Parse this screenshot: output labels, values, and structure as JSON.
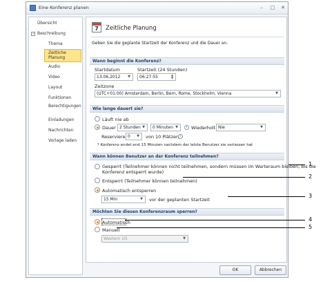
{
  "window": {
    "title": "Eine Konferenz planen"
  },
  "sidebar": {
    "items": [
      {
        "label": "Übersicht"
      },
      {
        "label": "Beschreibung"
      },
      {
        "label": "Thema"
      },
      {
        "label": "Zeitliche Planung"
      },
      {
        "label": "Audio"
      },
      {
        "label": "Video"
      },
      {
        "label": "Layout"
      },
      {
        "label": "Funktionen"
      },
      {
        "label": "Berechtigungen"
      },
      {
        "label": "Einladungen"
      },
      {
        "label": "Nachrichten"
      },
      {
        "label": "Vorlage laden"
      }
    ]
  },
  "main": {
    "calendar_day": "7",
    "heading": "Zeitliche Planung",
    "description": "Geben Sie die geplante Startzeit der Konferenz und die Dauer an.",
    "start": {
      "section": "Wann beginnt die Konferenz?",
      "date_label": "Startdatum",
      "date_value": "13.06.2012",
      "time_label": "Startzeit (24 Stunden)",
      "time_value": "06:27:55",
      "zone_label": "Zeitzone",
      "zone_value": "(UTC+01:00) Amsterdam, Berlin, Bern, Rome, Stockholm, Vienna"
    },
    "duration": {
      "section": "Wie lange dauert sie?",
      "endless_label": "Läuft nie ab",
      "duration_label": "Dauer",
      "hours_value": "2 Stunden",
      "minutes_value": "0 Minuten",
      "repeat_label": "Wiederholt",
      "repeat_value": "Nie",
      "reserve_label": "Reservieren",
      "reserve_value": "0",
      "reserve_suffix": "von 10 Plätzen",
      "note": "* Konferenz endet erst 15 Minuten nachdem der letzte Benutzer sie verlassen hat"
    },
    "entry": {
      "section": "Wann können Benutzer an der Konferenz teilnehmen?",
      "locked_label_line1": "Gesperrt (Teilnehmer können nicht teilnehmen, sondern müssen im Warteraum bleiben, bis die",
      "locked_label_line2": "Konferenz entsperrt wurde)",
      "unlocked_label": "Entsperrt (Teilnehmer können teilnehmen)",
      "auto_unlock_label": "Automatisch entsperren",
      "auto_unlock_value": "15 Min",
      "auto_unlock_suffix": "vor der geplanten Startzeit"
    },
    "lock": {
      "section": "Möchten Sie diesen Konferenzraum sperren?",
      "auto_label": "Automatisch",
      "manual_label": "Manuell",
      "room_value": "Western US"
    }
  },
  "footer": {
    "ok_label": "OK",
    "cancel_label": "Abbrechen"
  },
  "callouts": [
    "1",
    "2",
    "3",
    "4",
    "5"
  ]
}
